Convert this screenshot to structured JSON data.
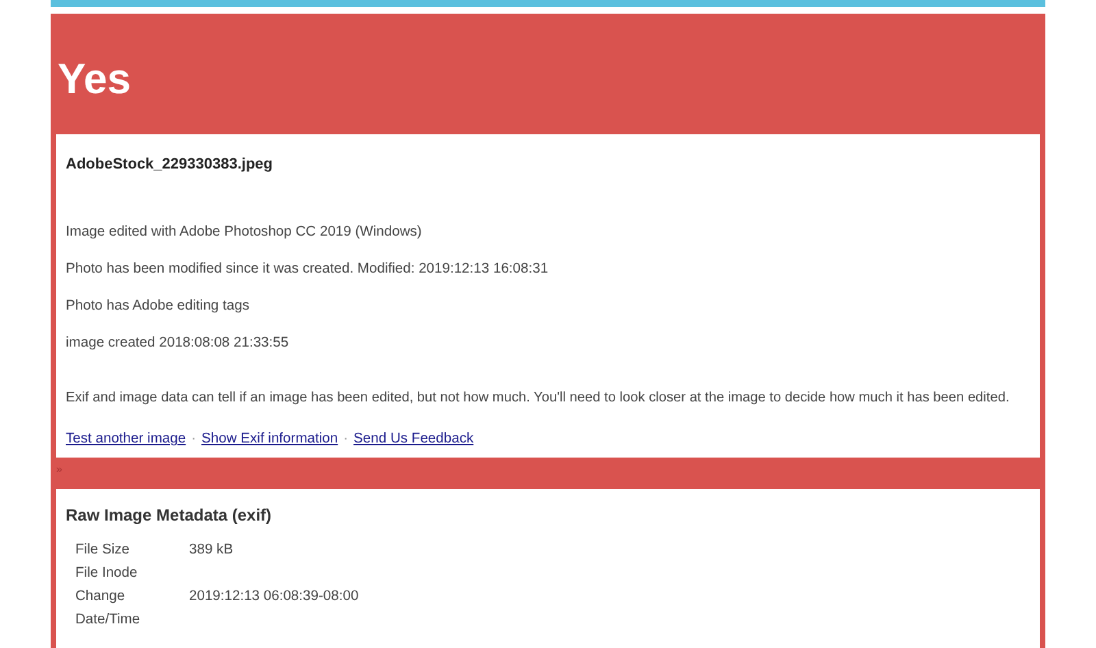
{
  "verdict": "Yes",
  "result": {
    "filename": "AdobeStock_229330383.jpeg",
    "findings": [
      "Image edited with Adobe Photoshop CC 2019 (Windows)",
      "Photo has been modified since it was created. Modified: 2019:12:13 16:08:31",
      "Photo has Adobe editing tags",
      "image created 2018:08:08 21:33:55"
    ],
    "note": "Exif and image data can tell if an image has been edited, but not how much. You'll need to look closer at the image to decide how much it has been edited.",
    "links": [
      "Test another image",
      "Show Exif information",
      "Send Us Feedback"
    ],
    "link_separators": [
      "·",
      "·"
    ]
  },
  "divider_mark": "»",
  "metadata": {
    "title": "Raw Image Metadata (exif)",
    "rows": [
      {
        "label": "File Size",
        "value": "389 kB"
      },
      {
        "label": "File Inode"
      },
      {
        "label": "Change Date/Time",
        "value": "2019:12:13 06:08:39-08:00"
      }
    ]
  }
}
